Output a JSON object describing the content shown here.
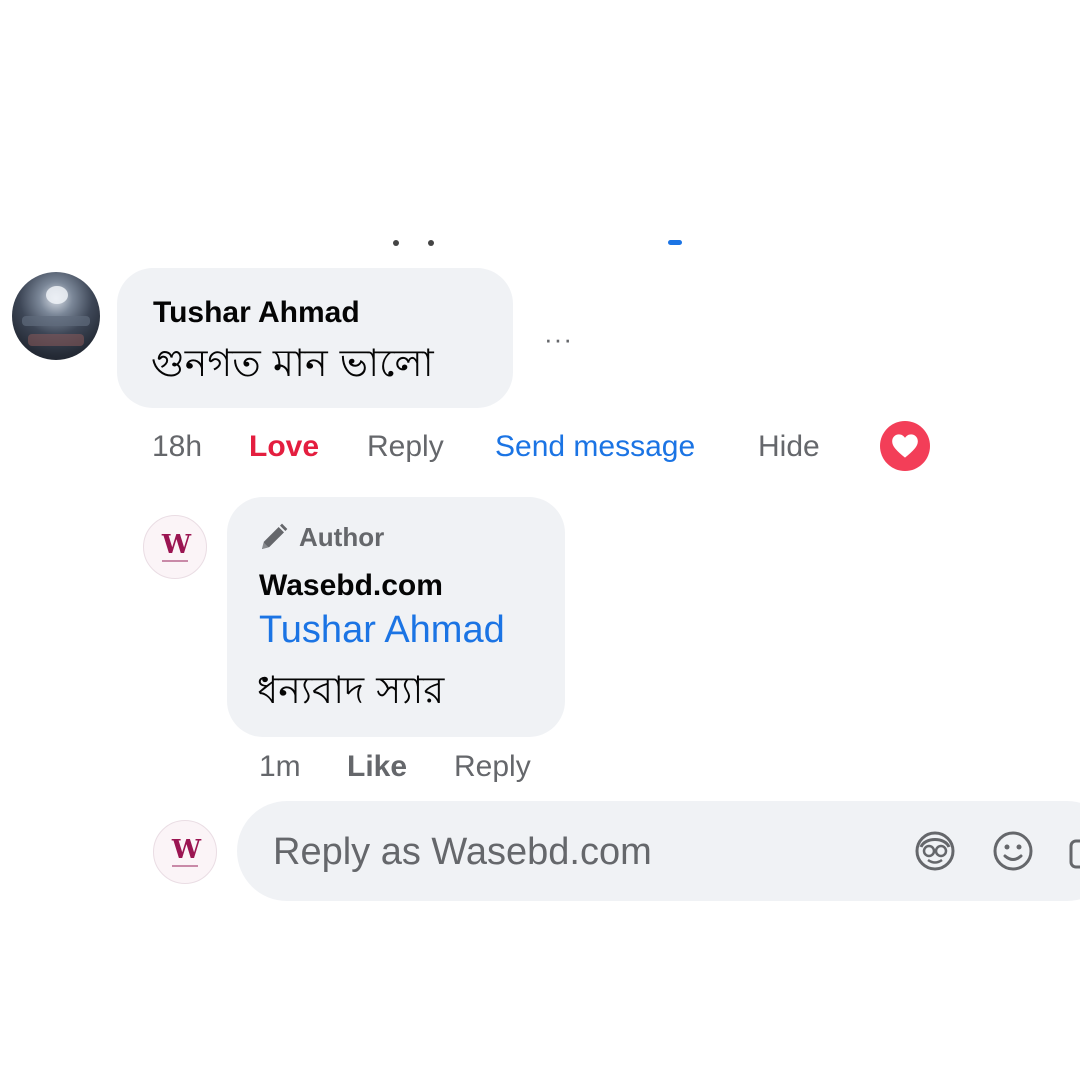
{
  "comment": {
    "author": "Tushar Ahmad",
    "text": "গুনগত মান ভালো",
    "more_label": "···",
    "time": "18h",
    "actions": {
      "love": "Love",
      "reply": "Reply",
      "send_message": "Send message",
      "hide": "Hide"
    },
    "reaction": "love-icon"
  },
  "reply": {
    "badge": "Author",
    "author": "Wasebd.com",
    "mention": "Tushar Ahmad",
    "text": "ধন্যবাদ স্যার",
    "time": "1m",
    "actions": {
      "like": "Like",
      "reply": "Reply"
    }
  },
  "composer": {
    "placeholder": "Reply as Wasebd.com",
    "icons": [
      "avatar-sticker-icon",
      "emoji-icon",
      "camera-icon"
    ]
  },
  "colors": {
    "love": "#e41e3f",
    "link": "#1b74e4",
    "muted": "#65676b",
    "bubble": "#f0f2f5",
    "reaction": "#f33e58"
  }
}
